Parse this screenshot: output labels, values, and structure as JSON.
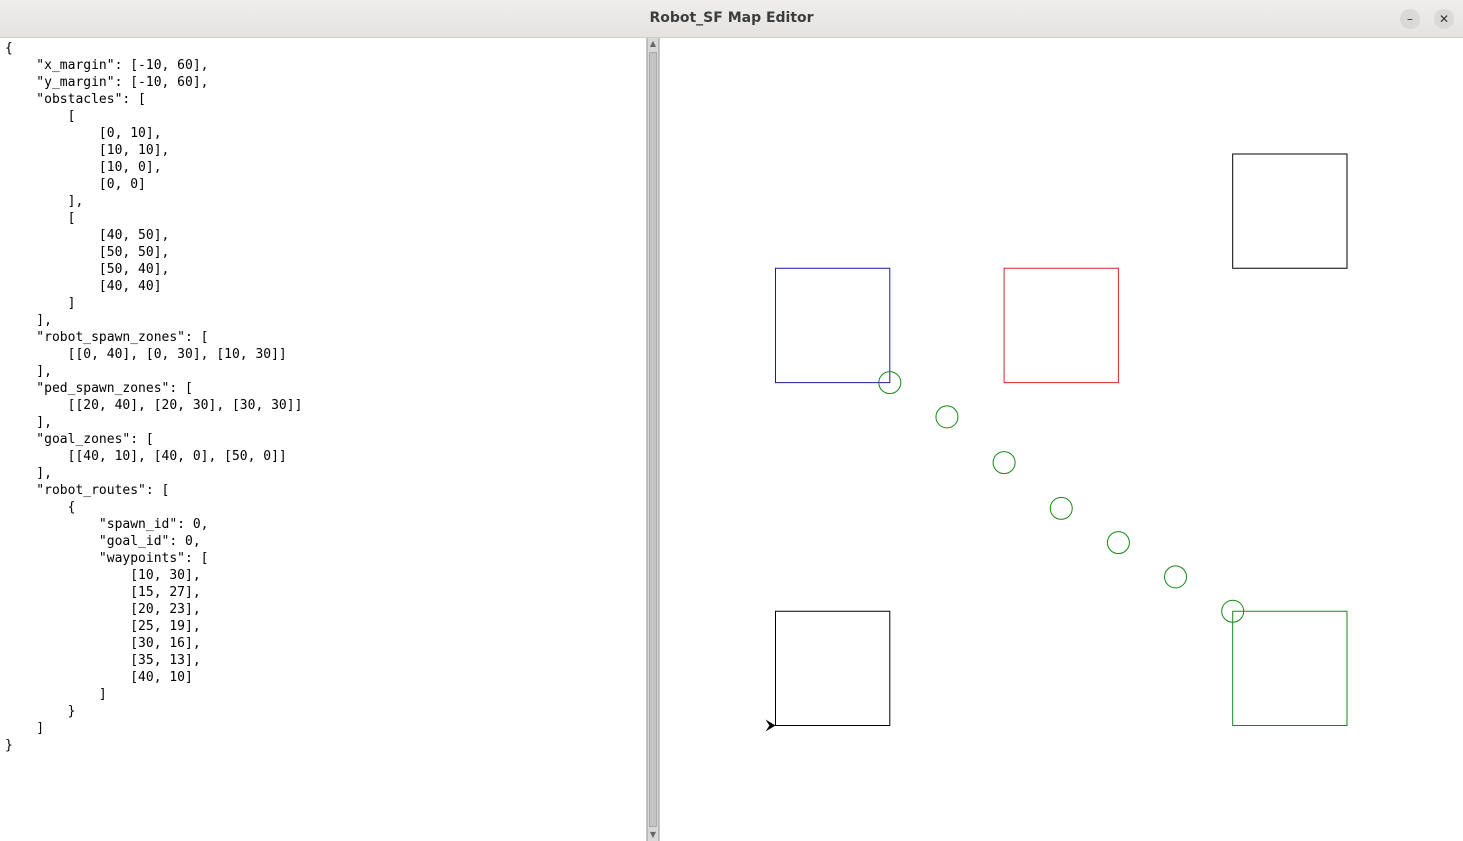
{
  "window": {
    "title": "Robot_SF Map Editor",
    "minimize_glyph": "–",
    "close_glyph": "✕"
  },
  "editor": {
    "text": "{\n    \"x_margin\": [-10, 60],\n    \"y_margin\": [-10, 60],\n    \"obstacles\": [\n        [\n            [0, 10],\n            [10, 10],\n            [10, 0],\n            [0, 0]\n        ],\n        [\n            [40, 50],\n            [50, 50],\n            [50, 40],\n            [40, 40]\n        ]\n    ],\n    \"robot_spawn_zones\": [\n        [[0, 40], [0, 30], [10, 30]]\n    ],\n    \"ped_spawn_zones\": [\n        [[20, 40], [20, 30], [30, 30]]\n    ],\n    \"goal_zones\": [\n        [[40, 10], [40, 0], [50, 0]]\n    ],\n    \"robot_routes\": [\n        {\n            \"spawn_id\": 0,\n            \"goal_id\": 0,\n            \"waypoints\": [\n                [10, 30],\n                [15, 27],\n                [20, 23],\n                [25, 19],\n                [30, 16],\n                [35, 13],\n                [40, 10]\n            ]\n        }\n    ]\n}"
  },
  "map": {
    "x_margin": [
      -10,
      60
    ],
    "y_margin": [
      -10,
      60
    ],
    "obstacles": [
      [
        [
          0,
          10
        ],
        [
          10,
          10
        ],
        [
          10,
          0
        ],
        [
          0,
          0
        ]
      ],
      [
        [
          40,
          50
        ],
        [
          50,
          50
        ],
        [
          50,
          40
        ],
        [
          40,
          40
        ]
      ]
    ],
    "robot_spawn_zones": [
      [
        [
          0,
          40
        ],
        [
          0,
          30
        ],
        [
          10,
          30
        ]
      ]
    ],
    "ped_spawn_zones": [
      [
        [
          20,
          40
        ],
        [
          20,
          30
        ],
        [
          30,
          30
        ]
      ]
    ],
    "goal_zones": [
      [
        [
          40,
          10
        ],
        [
          40,
          0
        ],
        [
          50,
          0
        ]
      ]
    ],
    "waypoints": [
      [
        10,
        30
      ],
      [
        15,
        27
      ],
      [
        20,
        23
      ],
      [
        25,
        19
      ],
      [
        30,
        16
      ],
      [
        35,
        13
      ],
      [
        40,
        10
      ]
    ],
    "colors": {
      "obstacle": "#000000",
      "robot_spawn": "#1a1aa6",
      "ped_spawn": "#d92626",
      "goal": "#138a13",
      "waypoint": "#138a13",
      "robot": "#000000"
    }
  }
}
